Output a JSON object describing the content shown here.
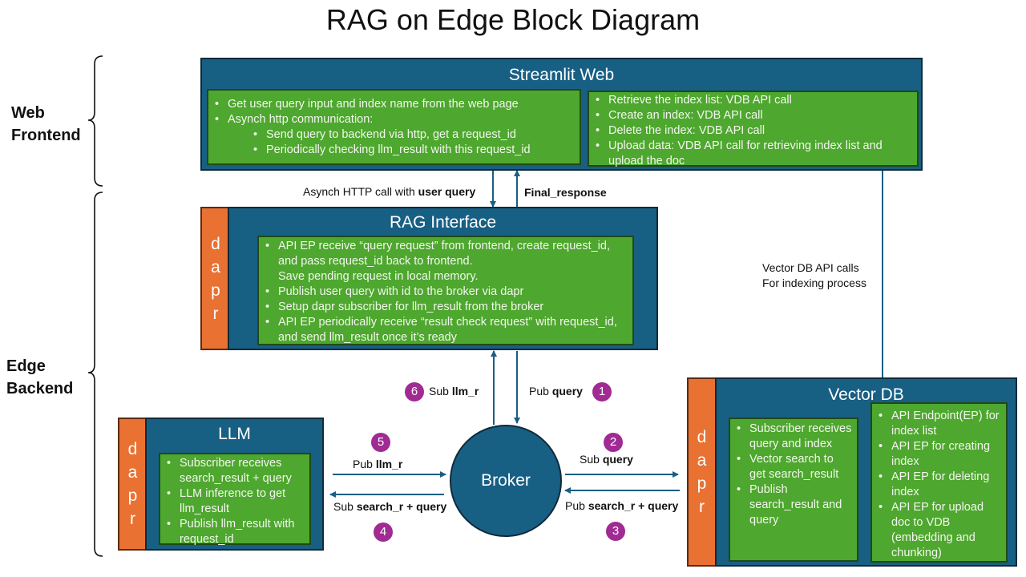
{
  "title": "RAG on Edge Block Diagram",
  "sections": {
    "web_frontend": "Web\nFrontend",
    "edge_backend": "Edge\nBackend"
  },
  "streamlit": {
    "title": "Streamlit Web",
    "left_items": [
      "Get user query input and index name from the web page",
      "Asynch http communication:",
      "Send query to backend via http, get a request_id",
      "Periodically checking llm_result with this request_id"
    ],
    "right_items": [
      "Retrieve the index list: VDB API call",
      "Create an index: VDB API call",
      "Delete the index: VDB API call",
      "Upload data: VDB API call for retrieving index list and upload the doc"
    ]
  },
  "rag_interface": {
    "title": "RAG Interface",
    "sidecar": [
      "d",
      "a",
      "p",
      "r"
    ],
    "items": [
      "API EP receive “query request” from frontend, create request_id, and pass request_id back to frontend.",
      "Save pending request in local memory.",
      "Publish user query with id to the broker via dapr",
      "Setup dapr subscriber for llm_result from the broker",
      "API EP periodically receive “result check request” with request_id, and send llm_result once it’s ready"
    ]
  },
  "llm": {
    "title": "LLM",
    "sidecar": [
      "d",
      "a",
      "p",
      "r"
    ],
    "items": [
      "Subscriber receives search_result + query",
      "LLM inference to get llm_result",
      "Publish llm_result with request_id"
    ]
  },
  "vector_db": {
    "title": "Vector DB",
    "sidecar": [
      "d",
      "a",
      "p",
      "r"
    ],
    "left_items": [
      "Subscriber receives query and index",
      "Vector search to get search_result",
      "Publish search_result and query"
    ],
    "right_items": [
      "API Endpoint(EP) for index list",
      "API EP for creating index",
      "API EP for deleting index",
      "API EP for upload doc to VDB (embedding and chunking)"
    ]
  },
  "broker": {
    "label": "Broker"
  },
  "edges": {
    "http_call": {
      "prefix": "Asynch HTTP call with ",
      "bold": "user query"
    },
    "final_response": {
      "bold": "Final_response"
    },
    "vdb_api": {
      "line1": "Vector DB API calls",
      "line2": "For indexing process"
    },
    "step1": {
      "num": "1",
      "prefix": "Pub ",
      "bold": "query"
    },
    "step2": {
      "num": "2",
      "prefix": "Sub ",
      "bold": "query"
    },
    "step3": {
      "num": "3",
      "prefix": "Pub ",
      "bold": "search_r + query"
    },
    "step4": {
      "num": "4",
      "prefix": "Sub ",
      "bold": "search_r + query"
    },
    "step5": {
      "num": "5",
      "prefix": "Pub ",
      "bold": "llm_r"
    },
    "step6": {
      "num": "6",
      "prefix": "Sub ",
      "bold": "llm_r"
    }
  },
  "colors": {
    "block_blue": "#185f84",
    "green": "#4ea72e",
    "dapr_orange": "#e97132",
    "badge_purple": "#a02b93"
  }
}
